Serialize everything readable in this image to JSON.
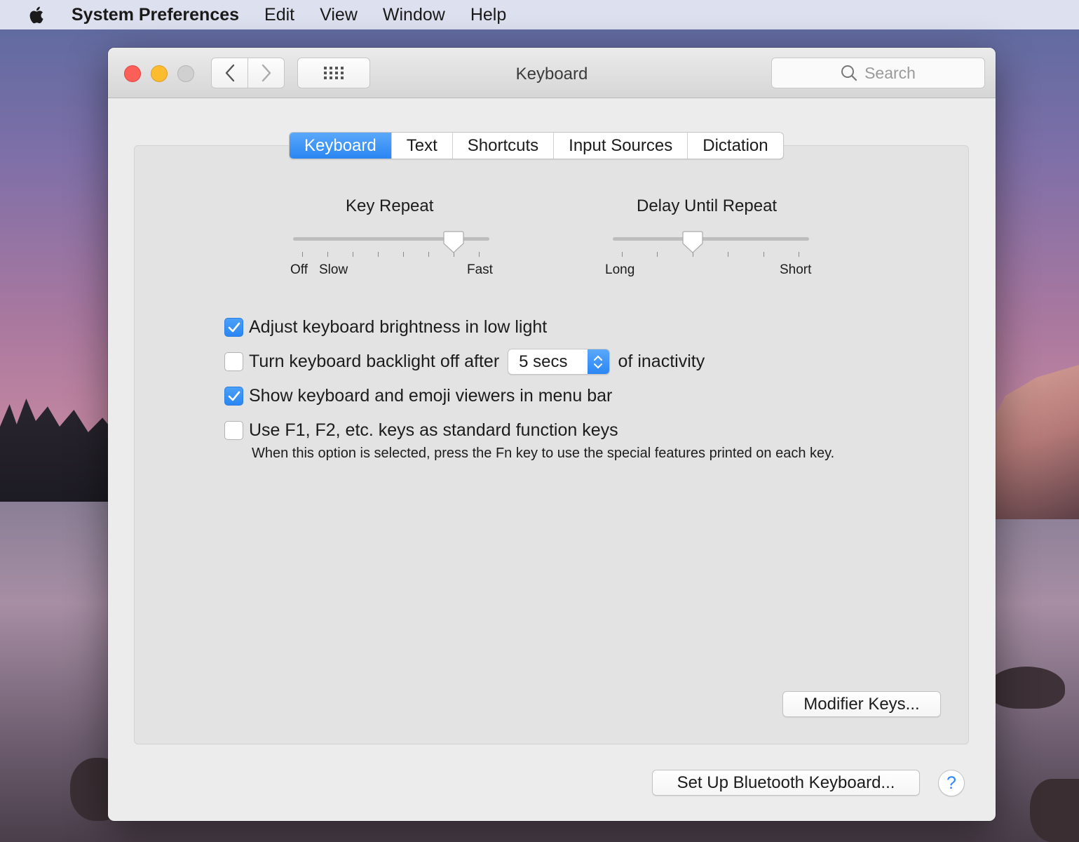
{
  "menubar": {
    "apple_icon": "apple-logo-icon",
    "app_name": "System Preferences",
    "items": [
      "Edit",
      "View",
      "Window",
      "Help"
    ]
  },
  "window": {
    "title": "Keyboard",
    "search_placeholder": "Search"
  },
  "tabs": [
    {
      "label": "Keyboard",
      "active": true
    },
    {
      "label": "Text",
      "active": false
    },
    {
      "label": "Shortcuts",
      "active": false
    },
    {
      "label": "Input Sources",
      "active": false
    },
    {
      "label": "Dictation",
      "active": false
    }
  ],
  "key_repeat": {
    "title": "Key Repeat",
    "label_off": "Off",
    "label_slow": "Slow",
    "label_fast": "Fast",
    "stops": 8,
    "value_index": 6
  },
  "delay_until_repeat": {
    "title": "Delay Until Repeat",
    "label_long": "Long",
    "label_short": "Short",
    "stops": 6,
    "value_index": 2
  },
  "options": {
    "brightness": {
      "label": "Adjust keyboard brightness in low light",
      "checked": true
    },
    "backlight": {
      "label": "Turn keyboard backlight off after",
      "checked": false,
      "popup_value": "5 secs",
      "suffix": "of inactivity"
    },
    "viewers": {
      "label": "Show keyboard and emoji viewers in menu bar",
      "checked": true
    },
    "fn_keys": {
      "label": "Use F1, F2, etc. keys as standard function keys",
      "checked": false,
      "hint": "When this option is selected, press the Fn key to use the special features printed on each key."
    }
  },
  "buttons": {
    "modifier_keys": "Modifier Keys...",
    "bluetooth": "Set Up Bluetooth Keyboard...",
    "help": "?"
  },
  "colors": {
    "accent": "#2a86f3",
    "close": "#fc5f57",
    "minimize": "#fdbc2e",
    "zoom_disabled": "#d0d0d0"
  }
}
